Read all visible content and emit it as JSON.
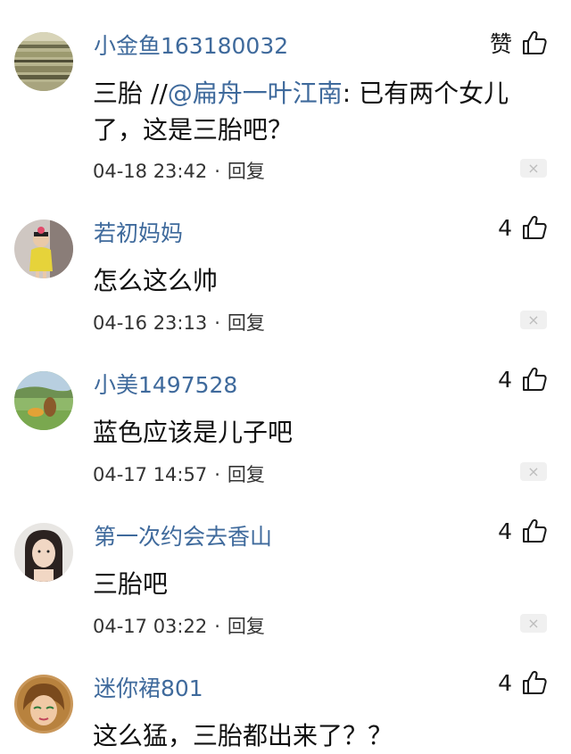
{
  "comments": [
    {
      "username": "小金鱼163180032",
      "like_label": "赞",
      "text_prefix": "三胎 //",
      "mention": "@扁舟一叶江南",
      "text_suffix": ": 已有两个女儿了，这是三胎吧？",
      "time": "04-18 23:42",
      "reply": "回复",
      "close_glyph": "×"
    },
    {
      "username": "若初妈妈",
      "likes": "4",
      "text": "怎么这么帅",
      "time": "04-16 23:13",
      "reply": "回复",
      "close_glyph": "×"
    },
    {
      "username": "小美1497528",
      "likes": "4",
      "text": "蓝色应该是儿子吧",
      "time": "04-17 14:57",
      "reply": "回复",
      "close_glyph": "×"
    },
    {
      "username": "第一次约会去香山",
      "likes": "4",
      "text": "三胎吧",
      "time": "04-17 03:22",
      "reply": "回复",
      "close_glyph": "×"
    },
    {
      "username": "迷你裙801",
      "likes": "4",
      "text": "这么猛，三胎都出来了？？"
    }
  ],
  "separator": "·",
  "icons": {
    "like": "thumbs-up-icon",
    "close": "close-icon"
  },
  "colors": {
    "username": "#3f6a9c",
    "text": "#111111",
    "close_bg": "#f0f0f0"
  }
}
